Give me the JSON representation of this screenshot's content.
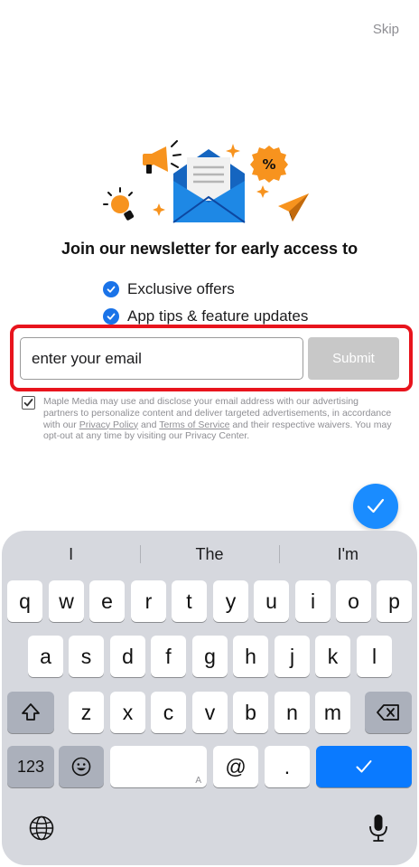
{
  "header": {
    "skip_label": "Skip"
  },
  "newsletter": {
    "headline": "Join our newsletter for early access to",
    "benefits": [
      "Exclusive offers",
      "App tips & feature updates"
    ],
    "email_placeholder": "enter your email",
    "submit_label": "Submit",
    "consent": {
      "text_1": "Maple Media may use and disclose your email address with our advertising partners to personalize content and deliver targeted advertisements, in accordance with our ",
      "privacy_link": "Privacy Policy",
      "text_2": " and ",
      "terms_link": "Terms of Service",
      "text_3": " and their respective waivers. You may opt-out at any time by visiting our Privacy Center.",
      "checked": true
    }
  },
  "keyboard": {
    "predictions": [
      "I",
      "The",
      "I'm"
    ],
    "row1": [
      "q",
      "w",
      "e",
      "r",
      "t",
      "y",
      "u",
      "i",
      "o",
      "p"
    ],
    "row2": [
      "a",
      "s",
      "d",
      "f",
      "g",
      "h",
      "j",
      "k",
      "l"
    ],
    "row3": [
      "z",
      "x",
      "c",
      "v",
      "b",
      "n",
      "m"
    ],
    "numbers_label": "123",
    "at_label": "@",
    "period_label": ".",
    "space_hint": "A"
  },
  "colors": {
    "accent": "#1a73e8",
    "highlight_border": "#e8141d",
    "submit_disabled": "#c8c8c8",
    "illustration_orange": "#f7931e",
    "envelope_blue": "#1565c0"
  },
  "icons": [
    "megaphone-icon",
    "envelope-icon",
    "percent-badge-icon",
    "sparkle-icon",
    "lightbulb-icon",
    "paper-plane-icon",
    "check-icon",
    "shift-icon",
    "backspace-icon",
    "emoji-icon",
    "globe-icon",
    "microphone-icon"
  ]
}
